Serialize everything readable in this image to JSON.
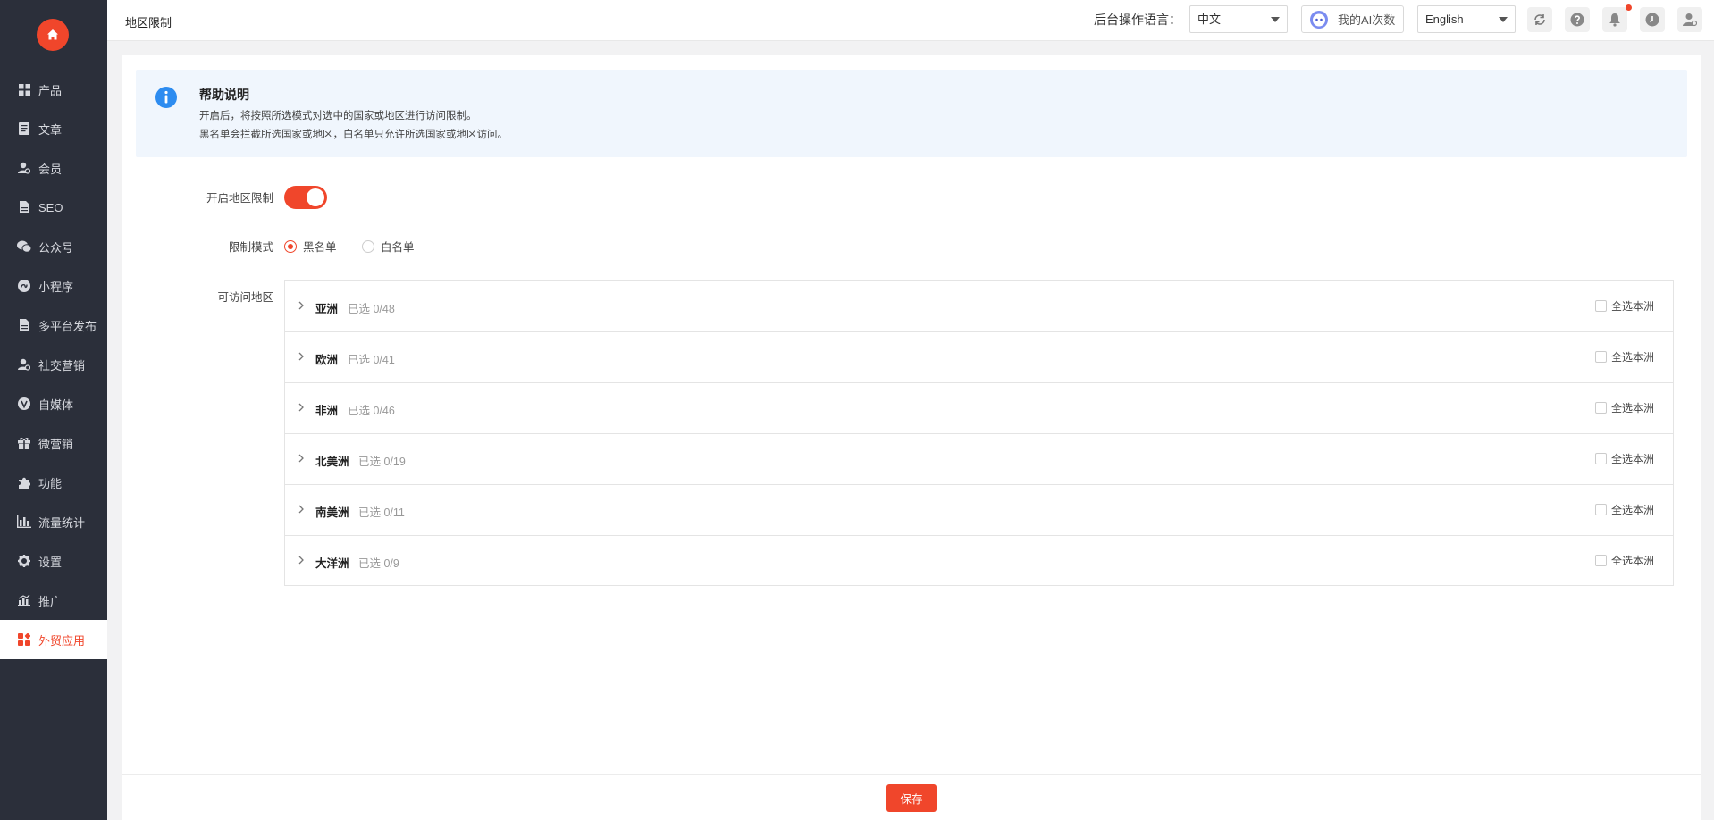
{
  "colors": {
    "accent": "#f0462b",
    "sidebar_bg": "#2b2f3a",
    "help_bg": "#f0f6fd",
    "info_blue": "#2d8cf0"
  },
  "sidebar": {
    "home_icon": "home-icon",
    "items": [
      {
        "label": "产品",
        "icon": "grid-icon"
      },
      {
        "label": "文章",
        "icon": "article-icon"
      },
      {
        "label": "会员",
        "icon": "member-icon"
      },
      {
        "label": "SEO",
        "icon": "file-icon"
      },
      {
        "label": "公众号",
        "icon": "wechat-icon"
      },
      {
        "label": "小程序",
        "icon": "miniprogram-icon"
      },
      {
        "label": "多平台发布",
        "icon": "publish-icon"
      },
      {
        "label": "社交营销",
        "icon": "social-icon"
      },
      {
        "label": "自媒体",
        "icon": "media-icon"
      },
      {
        "label": "微营销",
        "icon": "gift-icon"
      },
      {
        "label": "功能",
        "icon": "puzzle-icon"
      },
      {
        "label": "流量统计",
        "icon": "bar-chart-icon"
      },
      {
        "label": "设置",
        "icon": "gear-icon"
      },
      {
        "label": "推广",
        "icon": "promote-icon"
      },
      {
        "label": "外贸应用",
        "icon": "apps-icon",
        "active": true
      }
    ]
  },
  "header": {
    "title": "地区限制",
    "lang_label": "后台操作语言：",
    "lang_select": "中文",
    "ai_button": "我的AI次数",
    "ui_lang_select": "English"
  },
  "help": {
    "title": "帮助说明",
    "line1": "开启后，将按照所选模式对选中的国家或地区进行访问限制。",
    "line2": "黑名单会拦截所选国家或地区，白名单只允许所选国家或地区访问。"
  },
  "form": {
    "enable_label": "开启地区限制",
    "enable_on": true,
    "mode_label": "限制模式",
    "mode_options": [
      "黑名单",
      "白名单"
    ],
    "mode_selected": "黑名单",
    "regions_label": "可访问地区",
    "select_all_label": "全选本洲",
    "regions": [
      {
        "name": "亚洲",
        "count": "已选 0/48"
      },
      {
        "name": "欧洲",
        "count": "已选 0/41"
      },
      {
        "name": "非洲",
        "count": "已选 0/46"
      },
      {
        "name": "北美洲",
        "count": "已选 0/19"
      },
      {
        "name": "南美洲",
        "count": "已选 0/11"
      },
      {
        "name": "大洋洲",
        "count": "已选 0/9"
      }
    ]
  },
  "footer": {
    "save_label": "保存"
  }
}
